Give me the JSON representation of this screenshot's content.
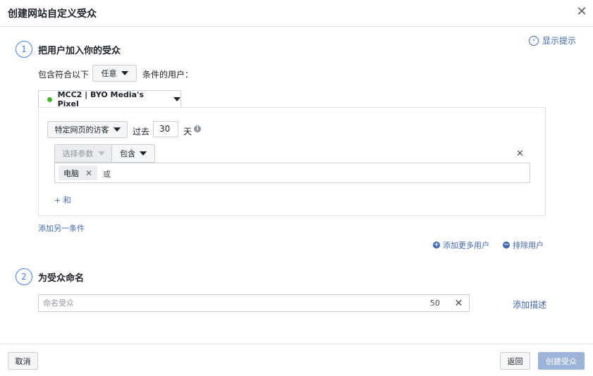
{
  "dialog": {
    "title": "创建网站自定义受众",
    "close_glyph": "✕"
  },
  "hint": {
    "label": "显示提示",
    "icon_glyph": "‹"
  },
  "step1": {
    "number": "1",
    "title": "把用户加入你的受众",
    "include_prefix": "包含符合以下",
    "match_value": "任意",
    "include_suffix": "条件的用户：",
    "pixel_name": "MCC2 | BYO Media's Pixel",
    "rule": {
      "traffic_type": "特定网页的访客",
      "past_label": "过去",
      "days_value": "30",
      "days_unit": "天",
      "info_glyph": "i",
      "param_placeholder": "选择参数",
      "operator": "包含",
      "remove_glyph": "✕",
      "chips": [
        {
          "label": "电脑",
          "remove_glyph": "✕"
        }
      ],
      "or_label": "或",
      "and_label": "+ 和"
    },
    "add_condition": "添加另一条件",
    "add_more_users": "添加更多用户",
    "add_icon_glyph": "+",
    "exclude_users": "排除用户",
    "exclude_icon_glyph": "−"
  },
  "step2": {
    "number": "2",
    "title": "为受众命名",
    "name_placeholder": "命名受众",
    "char_count": "50",
    "clear_glyph": "✕",
    "add_description": "添加描述"
  },
  "footer": {
    "cancel": "取消",
    "back": "返回",
    "create": "创建受众"
  }
}
